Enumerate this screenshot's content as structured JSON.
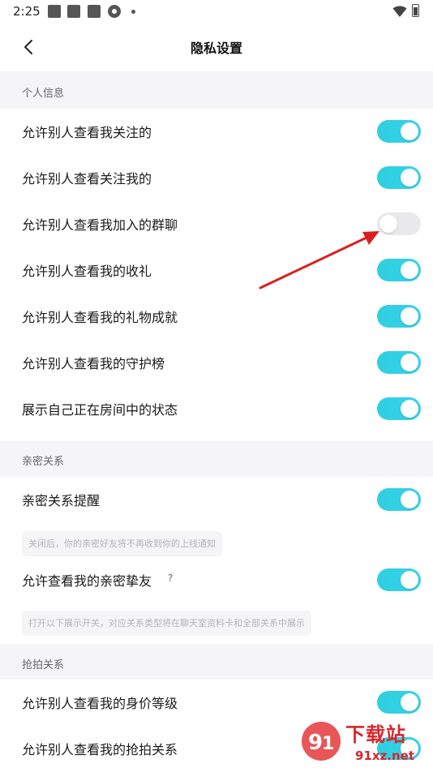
{
  "status_bar": {
    "time": "2:25"
  },
  "header": {
    "title": "隐私设置"
  },
  "sections": {
    "personal": {
      "title": "个人信息",
      "rows": [
        {
          "label": "允许别人查看我关注的",
          "enabled": true
        },
        {
          "label": "允许别人查看关注我的",
          "enabled": true
        },
        {
          "label": "允许别人查看我加入的群聊",
          "enabled": false
        },
        {
          "label": "允许别人查看我的收礼",
          "enabled": true
        },
        {
          "label": "允许别人查看我的礼物成就",
          "enabled": true
        },
        {
          "label": "允许别人查看我的守护榜",
          "enabled": true
        },
        {
          "label": "展示自己正在房间中的状态",
          "enabled": true
        }
      ]
    },
    "intimate": {
      "title": "亲密关系",
      "rows": [
        {
          "label": "亲密关系提醒",
          "enabled": true,
          "hint": "关闭后，你的亲密好友将不再收到你的上线通知"
        },
        {
          "label": "允许查看我的亲密挚友",
          "enabled": true,
          "help": "?",
          "hint": "打开以下展示开关，对应关系类型将在聊天室资料卡和全部关系中展示"
        }
      ]
    },
    "grab": {
      "title": "抢拍关系",
      "rows": [
        {
          "label": "允许别人查看我的身价等级",
          "enabled": true
        },
        {
          "label": "允许别人查看我的抢拍关系",
          "enabled": true
        }
      ]
    }
  },
  "watermark": {
    "brand": "下载站",
    "site": "91xz.net"
  },
  "colors": {
    "toggle_on": "#33d0e6",
    "toggle_off": "#e9e9ec",
    "section_bg": "#f5f5f7",
    "arrow": "#d9201f"
  }
}
